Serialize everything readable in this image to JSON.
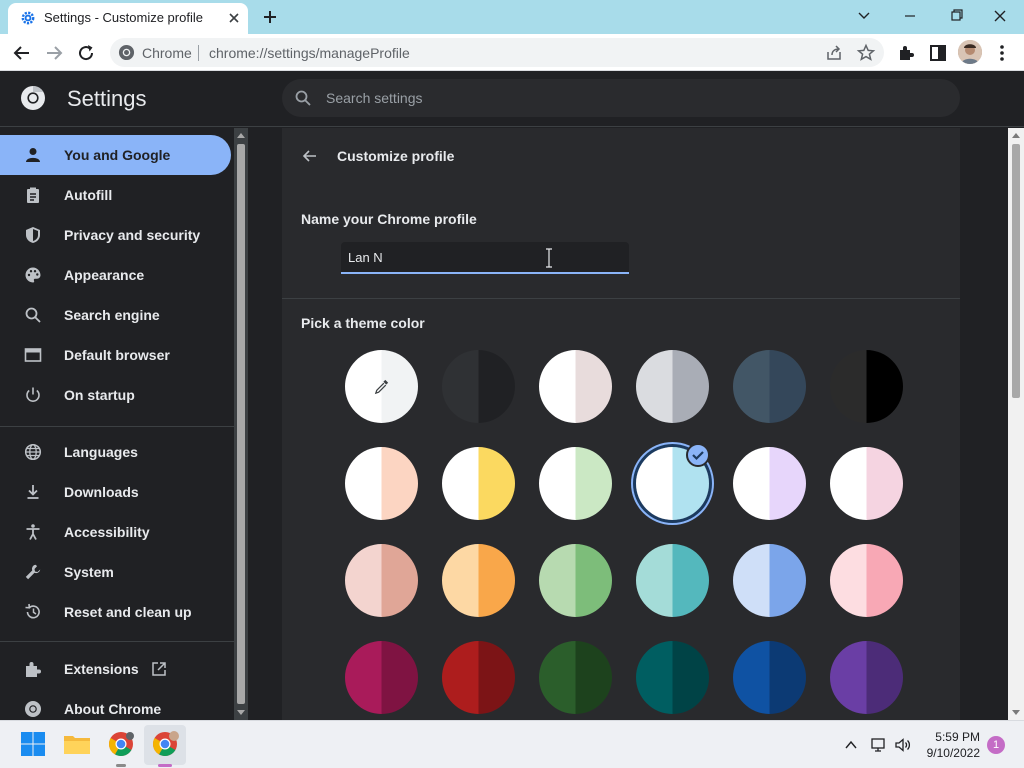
{
  "browser": {
    "tab_title": "Settings - Customize profile",
    "site_name": "Chrome",
    "url": "chrome://settings/manageProfile"
  },
  "settings": {
    "title": "Settings",
    "search_placeholder": "Search settings"
  },
  "sidebar": {
    "items": [
      {
        "label": "You and Google",
        "icon": "person-icon",
        "active": true
      },
      {
        "label": "Autofill",
        "icon": "clipboard-icon"
      },
      {
        "label": "Privacy and security",
        "icon": "shield-icon"
      },
      {
        "label": "Appearance",
        "icon": "palette-icon"
      },
      {
        "label": "Search engine",
        "icon": "search-icon"
      },
      {
        "label": "Default browser",
        "icon": "browser-window-icon"
      },
      {
        "label": "On startup",
        "icon": "power-icon"
      },
      {
        "label": "Languages",
        "icon": "globe-icon"
      },
      {
        "label": "Downloads",
        "icon": "download-icon"
      },
      {
        "label": "Accessibility",
        "icon": "accessibility-icon"
      },
      {
        "label": "System",
        "icon": "wrench-icon"
      },
      {
        "label": "Reset and clean up",
        "icon": "history-icon"
      },
      {
        "label": "Extensions",
        "icon": "puzzle-icon"
      },
      {
        "label": "About Chrome",
        "icon": "chrome-icon"
      }
    ]
  },
  "main": {
    "page_title": "Customize profile",
    "name_label": "Name your Chrome profile",
    "name_value": "Lan N",
    "theme_label": "Pick a theme color",
    "themes": [
      {
        "left": "#ffffff",
        "right": "#f1f3f4",
        "custom": true
      },
      {
        "left": "#2f3134",
        "right": "#202124"
      },
      {
        "left": "#ffffff",
        "right": "#e8dcdc"
      },
      {
        "left": "#dadce0",
        "right": "#a9adb6"
      },
      {
        "left": "#425666",
        "right": "#34475a"
      },
      {
        "left": "#2b2b2b",
        "right": "#000000"
      },
      {
        "left": "#ffffff",
        "right": "#fcd5c2"
      },
      {
        "left": "#ffffff",
        "right": "#fbd960"
      },
      {
        "left": "#ffffff",
        "right": "#cbe8c4"
      },
      {
        "left": "#ffffff",
        "right": "#b0e2f0",
        "selected": true
      },
      {
        "left": "#ffffff",
        "right": "#e7d6fb"
      },
      {
        "left": "#ffffff",
        "right": "#f5d4e1"
      },
      {
        "left": "#f3d4cf",
        "right": "#e0a697"
      },
      {
        "left": "#fdd8a4",
        "right": "#f9a74a"
      },
      {
        "left": "#b7dab0",
        "right": "#7dbd7a"
      },
      {
        "left": "#a4dcd8",
        "right": "#54b8bd"
      },
      {
        "left": "#cfdff8",
        "right": "#7ba5ea"
      },
      {
        "left": "#fddde1",
        "right": "#f8a8b5"
      },
      {
        "left": "#a91b5a",
        "right": "#7f1342"
      },
      {
        "left": "#ad1d1d",
        "right": "#7c1416"
      },
      {
        "left": "#2b5e2b",
        "right": "#1d421d"
      },
      {
        "left": "#005e61",
        "right": "#004346"
      },
      {
        "left": "#0f52a3",
        "right": "#0c3a74"
      },
      {
        "left": "#6a3ea5",
        "right": "#4c2c78"
      }
    ]
  },
  "taskbar": {
    "time": "5:59 PM",
    "date": "9/10/2022",
    "notifications": "1"
  },
  "colors": {
    "accent": "#8ab4f8",
    "title_bar": "#a8dcea",
    "background": "#202124",
    "card": "#292a2d"
  }
}
